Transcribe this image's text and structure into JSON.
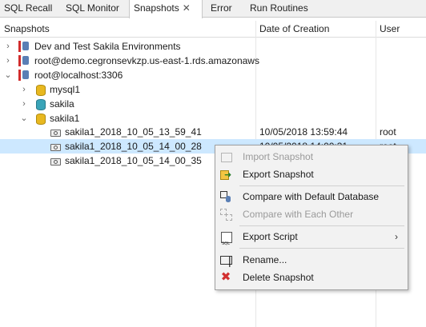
{
  "tabs": [
    {
      "label": "SQL Recall"
    },
    {
      "label": "SQL Monitor"
    },
    {
      "label": "Snapshots",
      "close": "✕"
    },
    {
      "label": "Error"
    },
    {
      "label": "Run Routines"
    }
  ],
  "columns": {
    "snapshots": "Snapshots",
    "date": "Date of Creation",
    "user": "User"
  },
  "tree": [
    {
      "label": "Dev and Test Sakila Environments",
      "twisty": "›",
      "icon": "server-icon"
    },
    {
      "label": "root@demo.cegronsevkzp.us-east-1.rds.amazonaws",
      "twisty": "›",
      "icon": "server-icon"
    },
    {
      "label": "root@localhost:3306",
      "twisty": "⌄",
      "icon": "server-icon"
    },
    {
      "label": "mysql1",
      "twisty": "›",
      "icon": "database-icon"
    },
    {
      "label": "sakila",
      "twisty": "›",
      "icon": "database-icon"
    },
    {
      "label": "sakila1",
      "twisty": "⌄",
      "icon": "database-icon"
    },
    {
      "label": "sakila1_2018_10_05_13_59_41",
      "icon": "snapshot-icon",
      "date": "10/05/2018 13:59:44",
      "user": "root"
    },
    {
      "label": "sakila1_2018_10_05_14_00_28",
      "icon": "snapshot-icon",
      "date": "10/05/2018 14:00:31",
      "user": "root"
    },
    {
      "label": "sakila1_2018_10_05_14_00_35",
      "icon": "snapshot-icon"
    }
  ],
  "context_menu": {
    "import": "Import Snapshot",
    "export": "Export Snapshot",
    "compare_default": "Compare with Default Database",
    "compare_each": "Compare with Each Other",
    "export_script": "Export Script",
    "submenu_arrow": "›",
    "rename": "Rename...",
    "delete": "Delete Snapshot",
    "delete_glyph": "✖"
  },
  "colors": {
    "selection": "#cde8ff",
    "menu_bg": "#f2f2f2",
    "delete_red": "#d23030"
  }
}
